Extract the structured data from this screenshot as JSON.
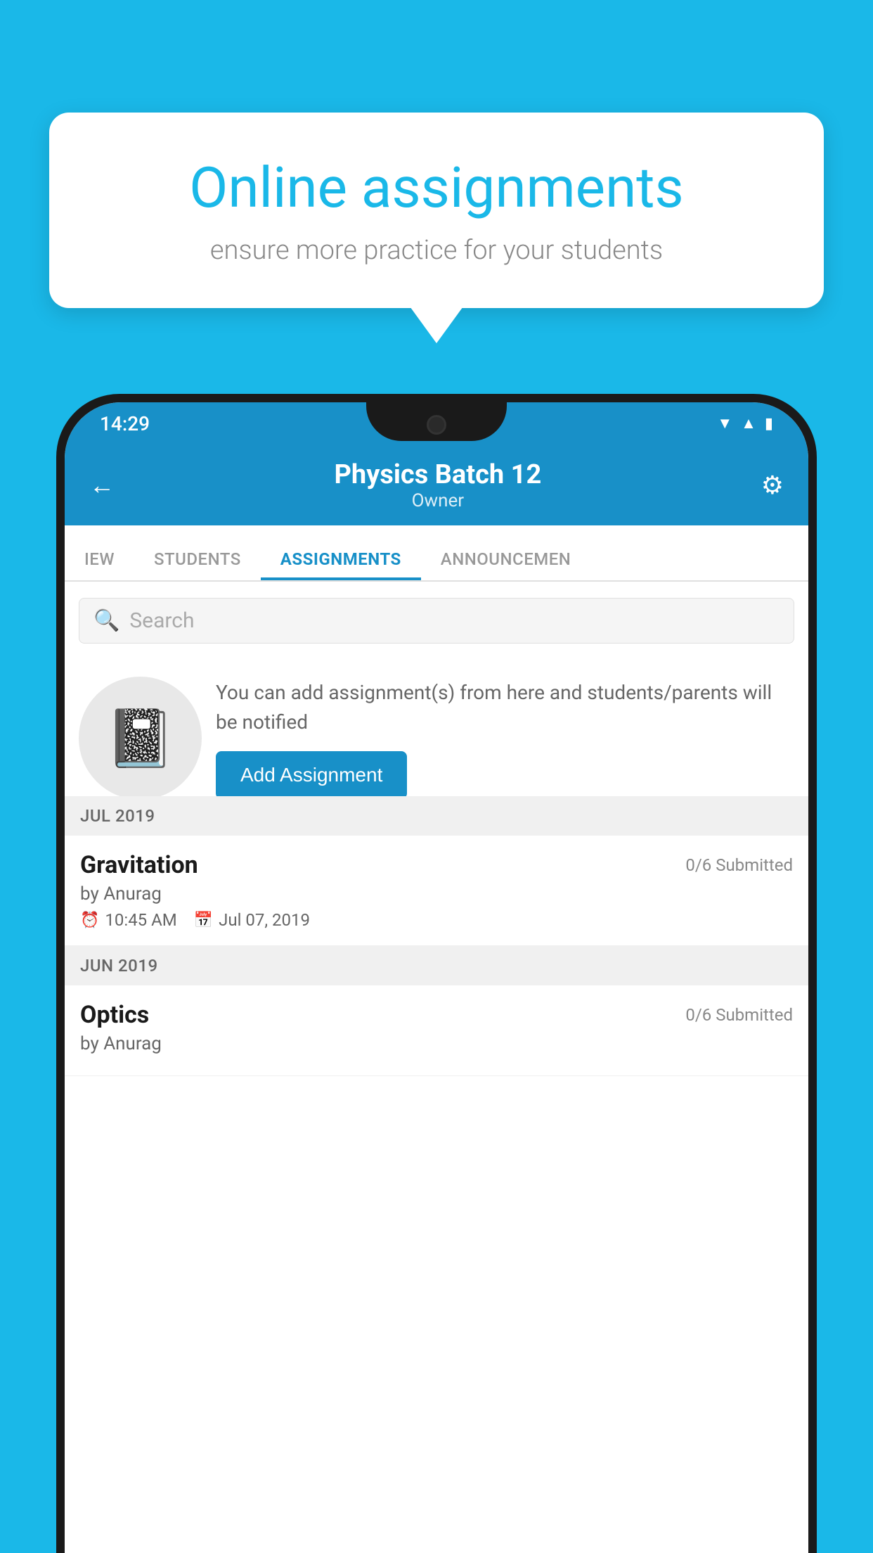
{
  "background_color": "#1ab8e8",
  "bubble": {
    "title": "Online assignments",
    "subtitle": "ensure more practice for your students"
  },
  "status_bar": {
    "time": "14:29",
    "wifi_icon": "wifi",
    "signal_icon": "signal",
    "battery_icon": "battery"
  },
  "header": {
    "title": "Physics Batch 12",
    "subtitle": "Owner",
    "back_label": "←",
    "settings_label": "⚙"
  },
  "tabs": [
    {
      "label": "IEW",
      "active": false
    },
    {
      "label": "STUDENTS",
      "active": false
    },
    {
      "label": "ASSIGNMENTS",
      "active": true
    },
    {
      "label": "ANNOUNCEMENTS",
      "active": false
    }
  ],
  "search": {
    "placeholder": "Search"
  },
  "promo": {
    "text": "You can add assignment(s) from here and students/parents will be notified",
    "button_label": "Add Assignment"
  },
  "sections": [
    {
      "month_label": "JUL 2019",
      "assignments": [
        {
          "title": "Gravitation",
          "submitted": "0/6 Submitted",
          "by": "by Anurag",
          "time": "10:45 AM",
          "date": "Jul 07, 2019"
        }
      ]
    },
    {
      "month_label": "JUN 2019",
      "assignments": [
        {
          "title": "Optics",
          "submitted": "0/6 Submitted",
          "by": "by Anurag",
          "time": "",
          "date": ""
        }
      ]
    }
  ]
}
